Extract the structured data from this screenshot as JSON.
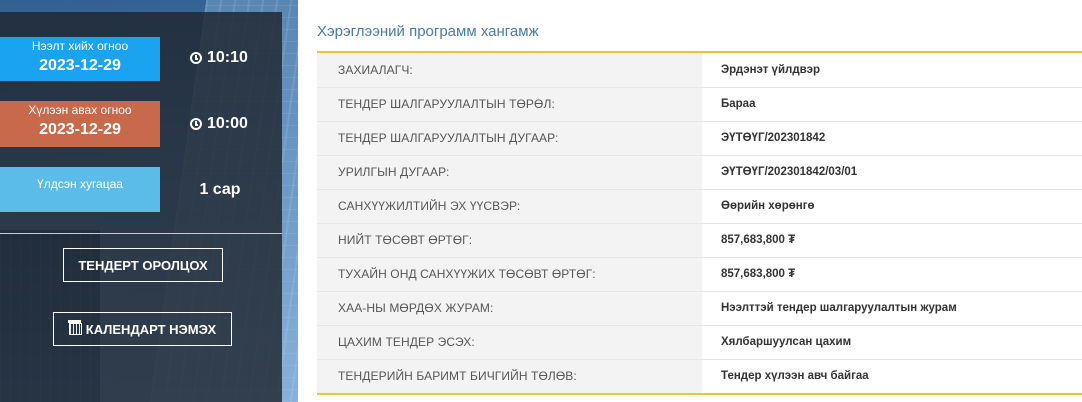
{
  "left_panel": {
    "open_date": {
      "label": "Нээлт хийх огноо",
      "date": "2023-12-29",
      "time": "10:10"
    },
    "close_date": {
      "label": "Хүлээн авах огноо",
      "date": "2023-12-29",
      "time": "10:00"
    },
    "duration": {
      "label": "Үлдсэн хугацаа",
      "value": "1 сар"
    },
    "participate_button": "ТЕНДЕРТ ОРОЛЦОХ",
    "calendar_button": "КАЛЕНДАРТ НЭМЭХ"
  },
  "main": {
    "section_title": "Хэрэглээний программ хангамж",
    "rows": [
      {
        "key": "ЗАХИАЛАГЧ:",
        "value": "Эрдэнэт үйлдвэр"
      },
      {
        "key": "ТЕНДЕР ШАЛГАРУУЛАЛТЫН ТӨРӨЛ:",
        "value": "Бараа"
      },
      {
        "key": "ТЕНДЕР ШАЛГАРУУЛАЛТЫН ДУГААР:",
        "value": "ЭҮТӨҮГ/202301842"
      },
      {
        "key": "УРИЛГЫН ДУГААР:",
        "value": "ЭҮТӨҮГ/202301842/03/01"
      },
      {
        "key": "САНХҮҮЖИЛТИЙН ЭХ ҮҮСВЭР:",
        "value": "Өөрийн хөрөнгө"
      },
      {
        "key": "НИЙТ ТӨСӨВТ ӨРТӨГ:",
        "value": "857,683,800 ₮"
      },
      {
        "key": "ТУХАЙН ОНД САНХҮҮЖИХ ТӨСӨВТ ӨРТӨГ:",
        "value": "857,683,800 ₮"
      },
      {
        "key": "ХАА-НЫ МӨРДӨХ ЖУРАМ:",
        "value": "Нээлттэй тендер шалгаруулалтын журам"
      },
      {
        "key": "ЦАХИМ ТЕНДЕР ЭСЭХ:",
        "value": "Хялбаршуулсан цахим"
      },
      {
        "key": "ТЕНДЕРИЙН БАРИМТ БИЧГИЙН ТӨЛӨВ:",
        "value": "Тендер хүлээн авч байгаа"
      }
    ]
  },
  "colors": {
    "accent_yellow": "#f2c230",
    "badge_blue": "#1aa3f0",
    "badge_orange": "#c9694c",
    "badge_light": "#5bbcea",
    "title_blue": "#4a7ba6"
  }
}
